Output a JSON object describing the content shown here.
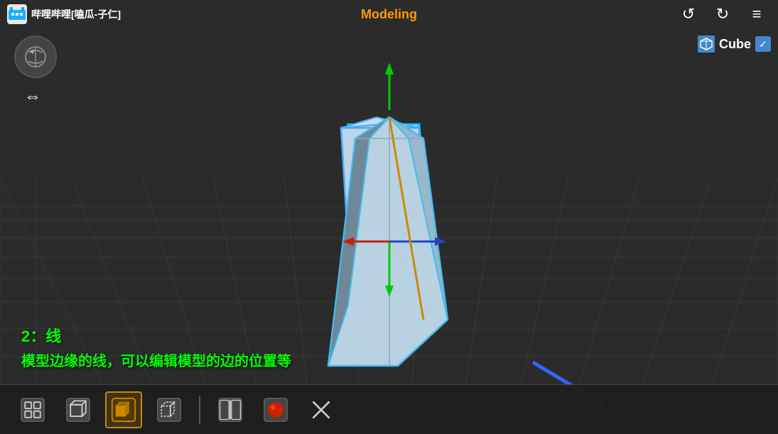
{
  "app": {
    "title": "哔哩哔哩[嗑瓜-子仁]",
    "logo_text": "bili"
  },
  "mode": {
    "label": "Modeling"
  },
  "top_right": {
    "undo_label": "↺",
    "redo_label": "↻",
    "menu_label": "≡"
  },
  "nav": {
    "orbit_icon": "↻",
    "pan_icon": "⇔"
  },
  "object": {
    "name": "Cube",
    "icon": "cube",
    "checked": true
  },
  "annotation": {
    "title": "2：线",
    "description": "模型边缘的线，可以编辑模型的边的位置等"
  },
  "toolbar": {
    "items": [
      {
        "id": "vertex-mode",
        "label": "顶点",
        "active": false
      },
      {
        "id": "edge-mode",
        "label": "边",
        "active": false
      },
      {
        "id": "face-mode",
        "label": "面",
        "active": true
      },
      {
        "id": "object-mode",
        "label": "对象",
        "active": false
      },
      {
        "id": "split",
        "label": "分割",
        "active": false
      },
      {
        "id": "material",
        "label": "材质",
        "active": false
      },
      {
        "id": "close",
        "label": "关闭",
        "active": false
      }
    ]
  },
  "colors": {
    "background": "#2a2a2a",
    "grid": "#3a3a3a",
    "active_mode_border": "#cc8800",
    "mode_label_color": "#ff9900",
    "annotation_color": "#00ff00",
    "object_panel_color": "#4488cc",
    "axis_x": "#cc2222",
    "axis_y": "#22cc22",
    "axis_z": "#2244cc"
  }
}
